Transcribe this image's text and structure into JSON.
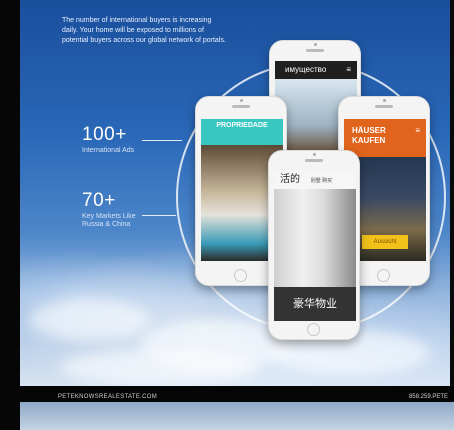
{
  "intro_text": "The number of international buyers is increasing daily. Your home will be exposed to millions of potential buyers across our global network of portals.",
  "stats": [
    {
      "value": "100+",
      "label": "International Ads"
    },
    {
      "value": "70+",
      "label": "Key Markets Like Russia & China"
    }
  ],
  "phones": {
    "russian": {
      "header": "имущество"
    },
    "portuguese": {
      "header": "PROPRIEDADE"
    },
    "german": {
      "header": "HÄUSER KAUFEN",
      "button": "Aussicht"
    },
    "chinese": {
      "header": "活的",
      "nav": "别墅 购买",
      "footer": "豪华物业"
    }
  },
  "footer": {
    "site": "PETEKNOWSREALESTATE.COM",
    "phone": "858.259.PETE"
  },
  "colors": {
    "portuguese_header": "#39c7c1",
    "german_header": "#e0641c",
    "german_button": "#f2c21b"
  }
}
